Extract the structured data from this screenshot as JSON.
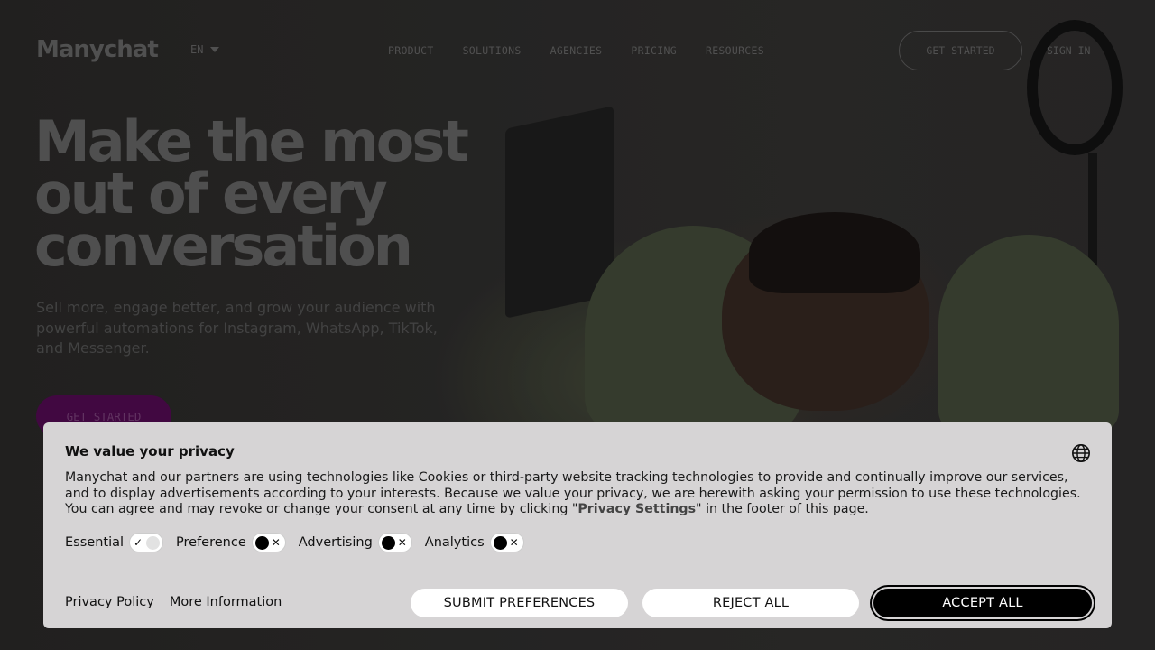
{
  "header": {
    "logo": "Manychat",
    "language": "EN",
    "nav": [
      "PRODUCT",
      "SOLUTIONS",
      "AGENCIES",
      "PRICING",
      "RESOURCES"
    ],
    "get_started": "GET STARTED",
    "sign_in": "SIGN IN"
  },
  "hero": {
    "title_lines": [
      "Make the most",
      "out of every",
      "conversation"
    ],
    "subtitle": "Sell more, engage better, and grow your audience with powerful automations for Instagram, WhatsApp, TikTok, and Messenger.",
    "cta": "GET STARTED"
  },
  "consent": {
    "title": "We value your privacy",
    "text_before": "Manychat and our partners are using technologies like Cookies or third-party website tracking technologies to provide and continually improve our services, and to display advertisements according to your interests. Because we value your privacy, we are herewith asking your permission to use these technologies. You can agree and may revoke or change your consent at any time by clicking \"",
    "privacy_settings_link": "Privacy Settings",
    "text_after": "\" in the footer of this page.",
    "toggles": [
      {
        "label": "Essential",
        "state": "on"
      },
      {
        "label": "Preference",
        "state": "off"
      },
      {
        "label": "Advertising",
        "state": "off"
      },
      {
        "label": "Analytics",
        "state": "off"
      }
    ],
    "links": {
      "privacy_policy": "Privacy Policy",
      "more_info": "More Information"
    },
    "buttons": {
      "submit": "SUBMIT PREFERENCES",
      "reject": "REJECT ALL",
      "accept": "ACCEPT ALL"
    },
    "icons": {
      "language": "globe-icon",
      "check": "✓",
      "cross": "✕"
    }
  }
}
